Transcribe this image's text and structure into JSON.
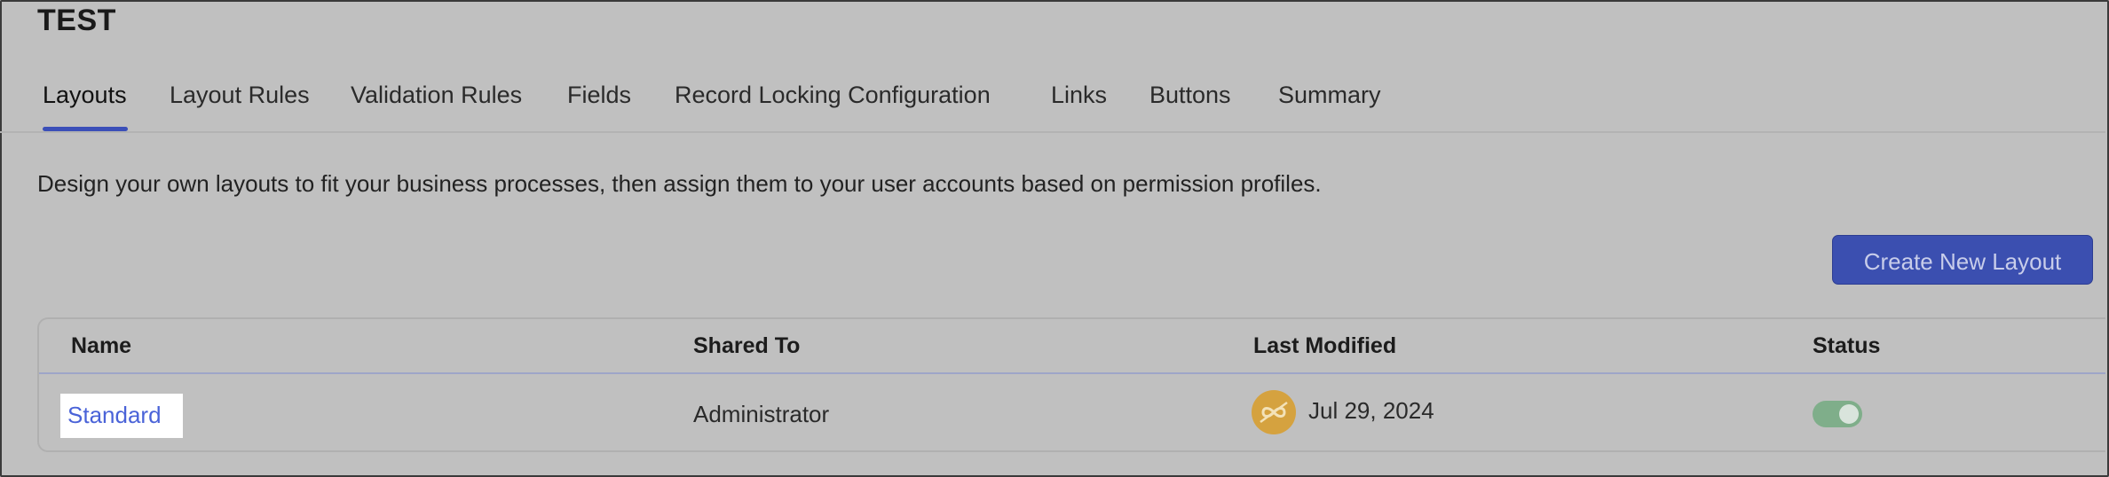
{
  "page": {
    "title": "TEST"
  },
  "tabs": [
    {
      "label": "Layouts",
      "active": true
    },
    {
      "label": "Layout Rules"
    },
    {
      "label": "Validation Rules"
    },
    {
      "label": "Fields"
    },
    {
      "label": "Record Locking Configuration"
    },
    {
      "label": "Links"
    },
    {
      "label": "Buttons"
    },
    {
      "label": "Summary"
    }
  ],
  "description": "Design your own layouts to fit your business processes, then assign them to your user accounts based on permission profiles.",
  "actions": {
    "create_label": "Create New Layout"
  },
  "table": {
    "columns": [
      "Name",
      "Shared To",
      "Last Modified",
      "Status"
    ],
    "rows": [
      {
        "name": "Standard",
        "shared_to": "Administrator",
        "last_modified": "Jul 29, 2024",
        "avatar_icon": "infinity-avatar-icon",
        "status_enabled": true
      }
    ]
  },
  "colors": {
    "accent": "#3b4fb0",
    "link": "#4a63d8",
    "toggle_on": "#7fae8a",
    "avatar": "#d5a23f"
  }
}
